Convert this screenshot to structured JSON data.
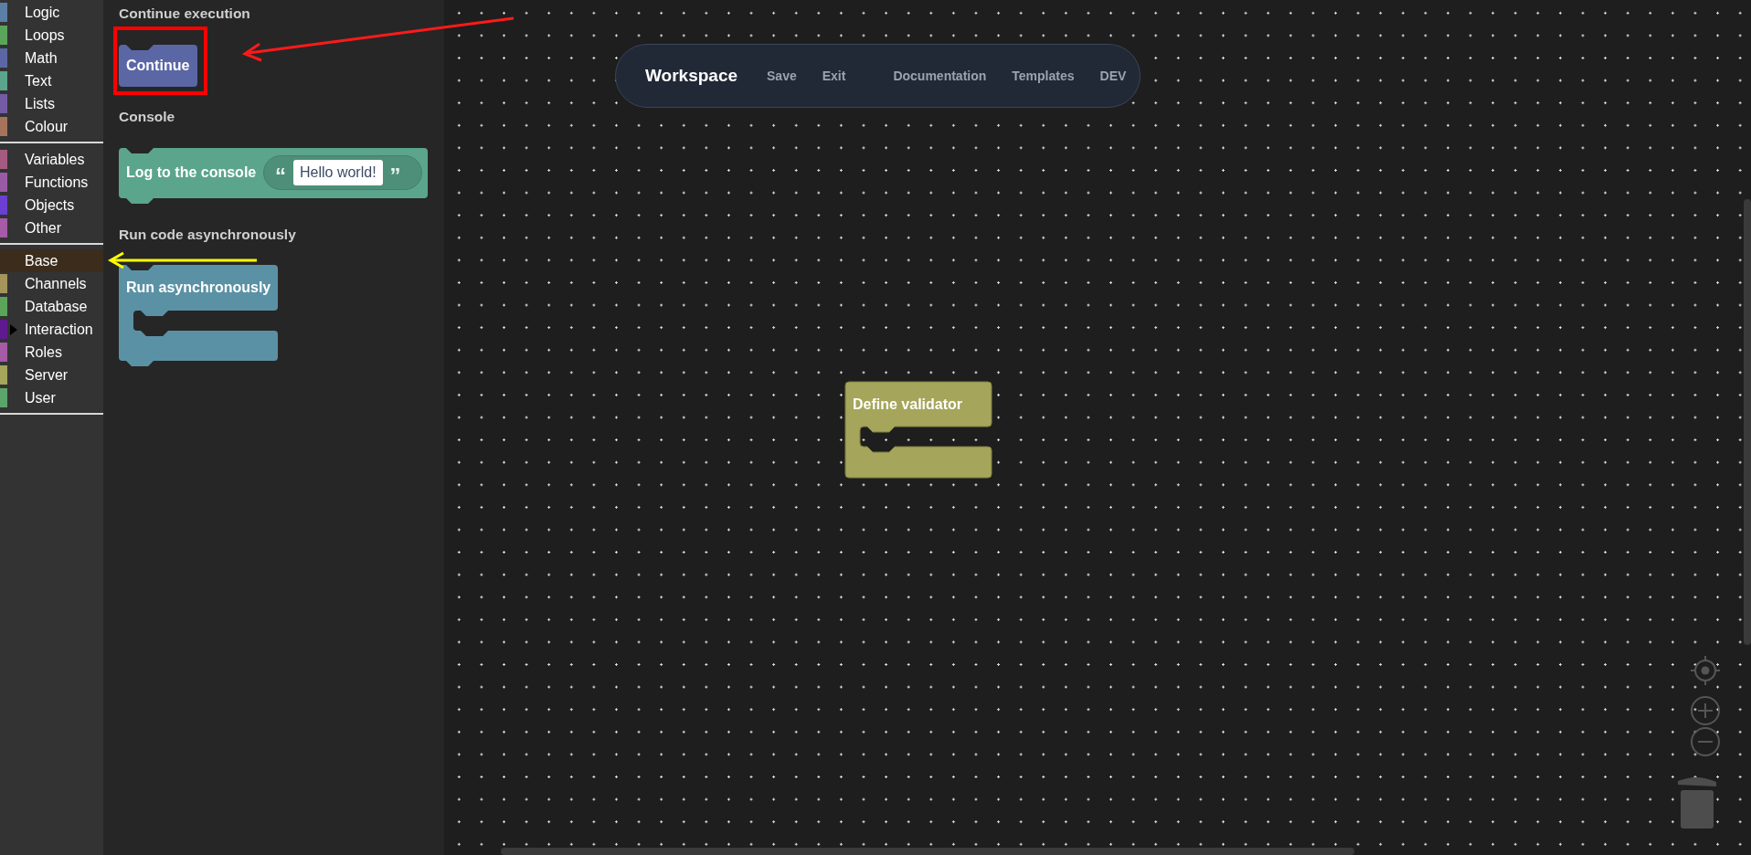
{
  "sidebar": {
    "groups": [
      {
        "items": [
          {
            "label": "Logic",
            "color": "#5b80a5",
            "selected": false,
            "kind": "leaf"
          },
          {
            "label": "Loops",
            "color": "#5ba55b",
            "selected": false,
            "kind": "leaf"
          },
          {
            "label": "Math",
            "color": "#5b67a5",
            "selected": false,
            "kind": "leaf"
          },
          {
            "label": "Text",
            "color": "#5ba58c",
            "selected": false,
            "kind": "leaf"
          },
          {
            "label": "Lists",
            "color": "#745ba5",
            "selected": false,
            "kind": "leaf"
          },
          {
            "label": "Colour",
            "color": "#a5745b",
            "selected": false,
            "kind": "leaf"
          }
        ]
      },
      {
        "items": [
          {
            "label": "Variables",
            "color": "#a55b80",
            "selected": false,
            "kind": "leaf"
          },
          {
            "label": "Functions",
            "color": "#995ba5",
            "selected": false,
            "kind": "leaf"
          },
          {
            "label": "Objects",
            "color": "#6a3fd1",
            "selected": false,
            "kind": "leaf"
          },
          {
            "label": "Other",
            "color": "#a55ba5",
            "selected": false,
            "kind": "leaf"
          }
        ]
      },
      {
        "items": [
          {
            "label": "Base",
            "color": "#3b2c1c",
            "selected": true,
            "kind": "leaf"
          },
          {
            "label": "Channels",
            "color": "#a5955b",
            "selected": false,
            "kind": "leaf"
          },
          {
            "label": "Database",
            "color": "#5ba55b",
            "selected": false,
            "kind": "leaf"
          },
          {
            "label": "Interaction",
            "color": "#5e1a8e",
            "selected": false,
            "kind": "parent"
          },
          {
            "label": "Roles",
            "color": "#a55ba5",
            "selected": false,
            "kind": "leaf"
          },
          {
            "label": "Server",
            "color": "#a5a55b",
            "selected": false,
            "kind": "leaf"
          },
          {
            "label": "User",
            "color": "#5ba56a",
            "selected": false,
            "kind": "leaf"
          }
        ]
      }
    ]
  },
  "flyout": {
    "sections": [
      {
        "heading": "Continue execution",
        "block": {
          "kind": "cap",
          "label": "Continue",
          "color": "#5b67a5"
        }
      },
      {
        "heading": "Console",
        "block": {
          "kind": "statement",
          "label": "Log to the console",
          "color": "#5ba58c",
          "input": {
            "open_quote": "“",
            "value": "Hello world!",
            "close_quote": "”"
          }
        }
      },
      {
        "heading": "Run code asynchronously",
        "block": {
          "kind": "c-block",
          "label": "Run asynchronously",
          "color": "#5b91a5"
        }
      }
    ]
  },
  "navbar": {
    "title": "Workspace",
    "links": [
      {
        "label": "Save"
      },
      {
        "label": "Exit"
      }
    ],
    "secondary_links": [
      {
        "label": "Documentation"
      },
      {
        "label": "Templates"
      },
      {
        "label": "DEV"
      }
    ]
  },
  "workspace": {
    "blocks": [
      {
        "kind": "container",
        "label": "Define validator",
        "color": "#a5a55b"
      }
    ]
  }
}
